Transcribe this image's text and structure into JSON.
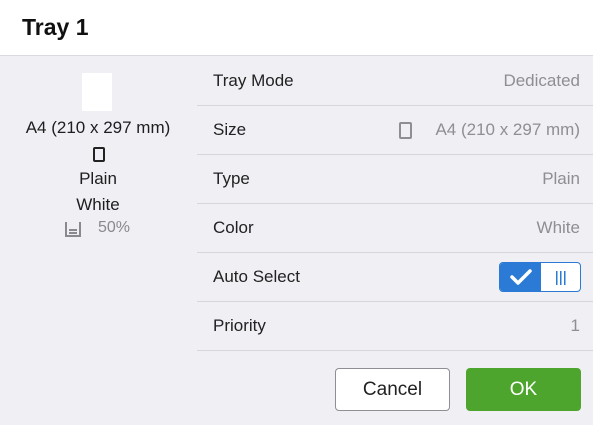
{
  "header": {
    "title": "Tray 1"
  },
  "summary": {
    "paper_size": "A4 (210 x 297 mm)",
    "orientation_icon": "portrait-icon",
    "type": "Plain",
    "color": "White",
    "level_icon": "paper-level-icon",
    "level_text": "50%"
  },
  "settings": {
    "tray_mode": {
      "label": "Tray Mode",
      "value": "Dedicated"
    },
    "size": {
      "label": "Size",
      "value": "A4 (210 x 297 mm)",
      "icon": "portrait-icon"
    },
    "type": {
      "label": "Type",
      "value": "Plain"
    },
    "color": {
      "label": "Color",
      "value": "White"
    },
    "auto_select": {
      "label": "Auto Select",
      "state": "on",
      "accent": "#2a7ad6"
    },
    "priority": {
      "label": "Priority",
      "value": "1"
    }
  },
  "buttons": {
    "cancel": "Cancel",
    "ok": "OK",
    "ok_color": "#4da52e"
  }
}
